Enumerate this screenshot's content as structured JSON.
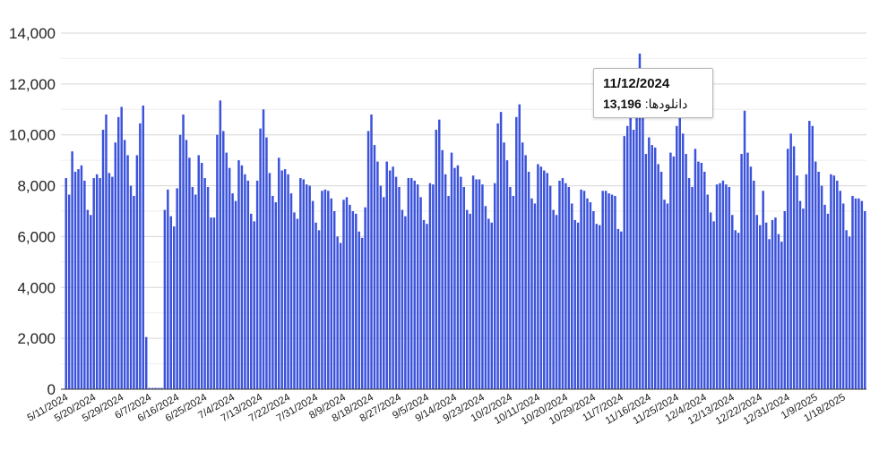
{
  "chart_data": {
    "type": "bar",
    "start_date": "2024-05-11",
    "series": [
      {
        "name": "دانلودها",
        "color": "#3b52db",
        "values": [
          8300,
          7650,
          9350,
          8550,
          8650,
          8800,
          8200,
          7050,
          6850,
          8300,
          8450,
          8300,
          10200,
          10800,
          8500,
          8350,
          9700,
          10700,
          11100,
          9800,
          9200,
          8000,
          7600,
          9200,
          10450,
          11150,
          2050,
          50,
          50,
          50,
          50,
          50,
          7050,
          7850,
          6800,
          6400,
          7900,
          10000,
          10800,
          9800,
          9100,
          7950,
          7650,
          9200,
          8900,
          8300,
          7950,
          6750,
          6750,
          10000,
          11350,
          10150,
          9300,
          8700,
          7700,
          7400,
          9000,
          8800,
          8450,
          8200,
          6900,
          6600,
          8200,
          10250,
          11000,
          9900,
          8500,
          7600,
          7350,
          9100,
          8600,
          8650,
          8450,
          7700,
          6950,
          6700,
          8300,
          8250,
          8050,
          8000,
          7400,
          6550,
          6250,
          7800,
          7850,
          7800,
          7500,
          7000,
          6000,
          5750,
          7450,
          7550,
          7250,
          7000,
          6900,
          6200,
          5950,
          7150,
          10150,
          10800,
          9600,
          8950,
          8000,
          7550,
          8950,
          8600,
          8750,
          8350,
          7950,
          7050,
          6800,
          8300,
          8300,
          8200,
          8050,
          7550,
          6650,
          6500,
          8100,
          8050,
          10200,
          10600,
          9400,
          8450,
          7600,
          9300,
          8700,
          8800,
          8350,
          7950,
          7050,
          6900,
          8400,
          8250,
          8250,
          8050,
          7200,
          6700,
          6550,
          8100,
          10450,
          10900,
          9700,
          9000,
          7950,
          7600,
          10700,
          11200,
          9700,
          9200,
          8550,
          7500,
          7300,
          8850,
          8750,
          8600,
          8500,
          8000,
          7050,
          6850,
          8200,
          8300,
          8100,
          7950,
          7300,
          6650,
          6550,
          7850,
          7800,
          7500,
          7350,
          7000,
          6500,
          6450,
          7800,
          7800,
          7700,
          7650,
          7600,
          6300,
          6200,
          9950,
          10350,
          10850,
          10200,
          11250,
          13196,
          11050,
          9250,
          9900,
          9600,
          9500,
          8850,
          8550,
          7450,
          7300,
          9300,
          9150,
          10350,
          11300,
          10050,
          9250,
          8300,
          7950,
          9450,
          8950,
          8900,
          8550,
          7650,
          6950,
          6600,
          8050,
          8100,
          8200,
          8050,
          7950,
          6850,
          6250,
          6150,
          9250,
          10950,
          9300,
          8750,
          8200,
          6850,
          6450,
          7800,
          6550,
          5900,
          6650,
          6750,
          6100,
          5800,
          7000,
          9450,
          10050,
          9550,
          8400,
          7400,
          7100,
          8450,
          10550,
          10350,
          8950,
          8550,
          8000,
          7250,
          6900,
          8450,
          8400,
          8200,
          7800,
          7300,
          6250,
          6000,
          7600,
          7500,
          7500,
          7400,
          7000
        ]
      }
    ],
    "ylim": [
      0,
      14000
    ],
    "yticks": [
      0,
      2000,
      4000,
      6000,
      8000,
      10000,
      12000,
      14000
    ],
    "y_tick_labels": [
      "0",
      "2,000",
      "4,000",
      "6,000",
      "8,000",
      "10,000",
      "12,000",
      "14,000"
    ],
    "x_tick_labels": [
      "5/11/2024",
      "5/20/2024",
      "5/29/2024",
      "6/7/2024",
      "6/16/2024",
      "6/25/2024",
      "7/4/2024",
      "7/13/2024",
      "7/22/2024",
      "7/31/2024",
      "8/9/2024",
      "8/18/2024",
      "8/27/2024",
      "9/5/2024",
      "9/14/2024",
      "9/23/2024",
      "10/2/2024",
      "10/11/2024",
      "10/20/2024",
      "10/29/2024",
      "11/7/2024",
      "11/16/2024",
      "11/25/2024",
      "12/4/2024",
      "12/13/2024",
      "12/22/2024",
      "12/31/2024",
      "1/9/2025",
      "1/18/2025"
    ],
    "x_tick_every": 9,
    "grid": true,
    "legend": "none",
    "colors": {
      "bar": "#3b52db",
      "grid": "#d6d6d6",
      "axis": "#333333"
    },
    "tooltip": {
      "index": 185,
      "date": "11/12/2024",
      "series_label": "دانلودها",
      "value_label": "13,196"
    }
  }
}
